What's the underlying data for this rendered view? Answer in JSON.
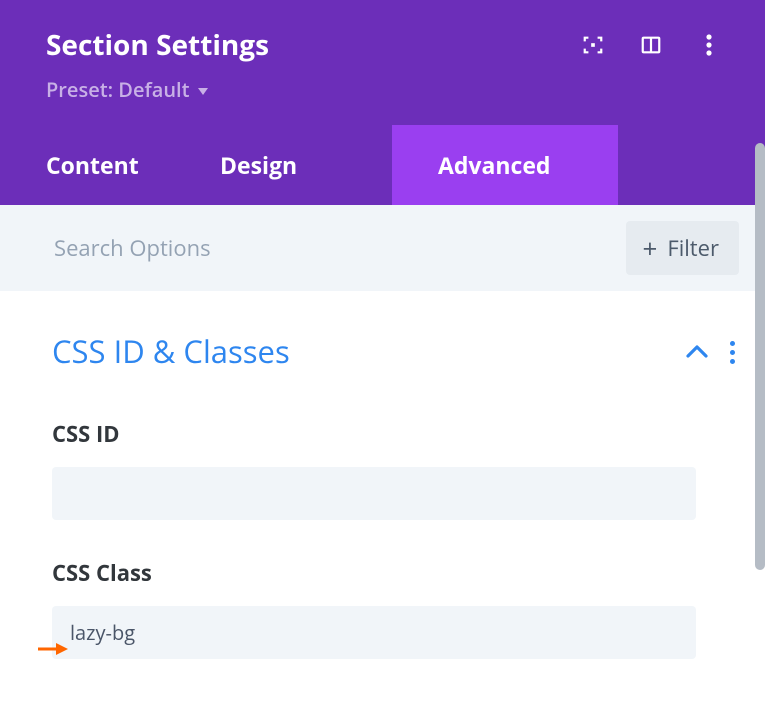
{
  "header": {
    "title": "Section Settings",
    "preset_label": "Preset: Default"
  },
  "tabs": {
    "content": "Content",
    "design": "Design",
    "advanced": "Advanced"
  },
  "searchbar": {
    "placeholder": "Search Options",
    "filter_label": "Filter"
  },
  "group": {
    "title": "CSS ID & Classes"
  },
  "fields": {
    "css_id_label": "CSS ID",
    "css_id_value": "",
    "css_class_label": "CSS Class",
    "css_class_value": "lazy-bg"
  }
}
